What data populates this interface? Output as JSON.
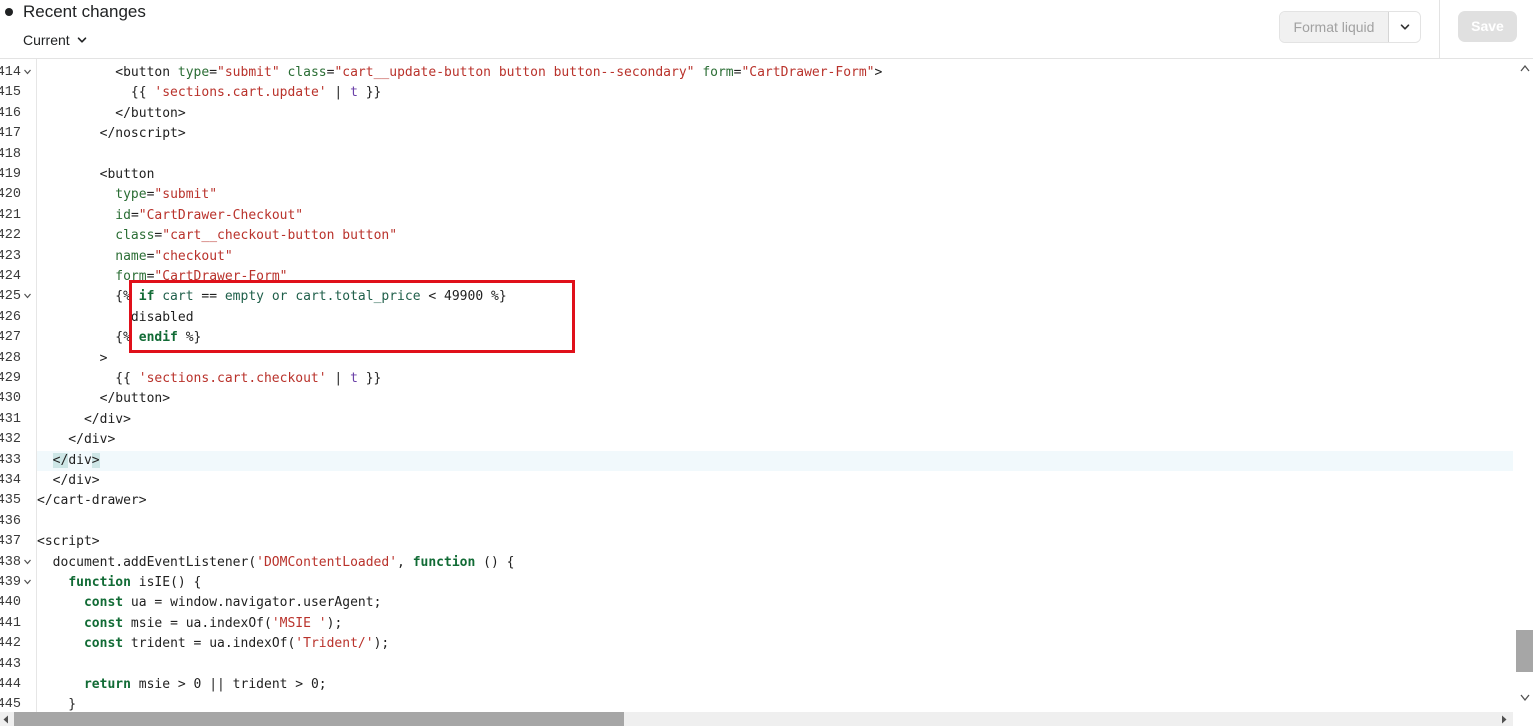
{
  "header": {
    "title": "Recent changes",
    "version_select": "Current",
    "format_button": "Format liquid",
    "save_button": "Save"
  },
  "editor": {
    "line_numbers": [
      "414",
      "415",
      "416",
      "417",
      "418",
      "419",
      "420",
      "421",
      "422",
      "423",
      "424",
      "425",
      "426",
      "427",
      "428",
      "429",
      "430",
      "431",
      "432",
      "433",
      "434",
      "435",
      "436",
      "437",
      "438",
      "439",
      "440",
      "441",
      "442",
      "443",
      "444",
      "445"
    ],
    "fold_lines": [
      "414",
      "425",
      "438",
      "439"
    ],
    "active_line": "433",
    "highlighted_lines": [
      "425",
      "426",
      "427"
    ],
    "lines": [
      "          <button type=\"submit\" class=\"cart__update-button button button--secondary\" form=\"CartDrawer-Form\">",
      "            {{ 'sections.cart.update' | t }}",
      "          </button>",
      "        </noscript>",
      "",
      "        <button",
      "          type=\"submit\"",
      "          id=\"CartDrawer-Checkout\"",
      "          class=\"cart__checkout-button button\"",
      "          name=\"checkout\"",
      "          form=\"CartDrawer-Form\"",
      "          {% if cart == empty or cart.total_price < 49900 %}",
      "            disabled",
      "          {% endif %}",
      "        >",
      "          {{ 'sections.cart.checkout' | t }}",
      "        </button>",
      "      </div>",
      "    </div>",
      "  </div>",
      "  </div>",
      "</cart-drawer>",
      "",
      "<script>",
      "  document.addEventListener('DOMContentLoaded', function () {",
      "    function isIE() {",
      "      const ua = window.navigator.userAgent;",
      "      const msie = ua.indexOf('MSIE ');",
      "      const trident = ua.indexOf('Trident/');",
      "",
      "      return msie > 0 || trident > 0;",
      "    }"
    ]
  },
  "colors": {
    "highlight_box": "#e0101a",
    "active_line_bg": "#f1f9fc",
    "string": "#b9322b",
    "attribute": "#2a6d34",
    "keyword": "#116b35"
  },
  "icons": {
    "version_chevron": "chevron-down-icon",
    "format_chevron": "chevron-down-icon",
    "fold": "fold-chevron-icon",
    "scroll_up": "triangle-up-icon",
    "scroll_down": "triangle-down-icon",
    "scroll_left": "triangle-left-icon",
    "scroll_right": "triangle-right-icon"
  }
}
